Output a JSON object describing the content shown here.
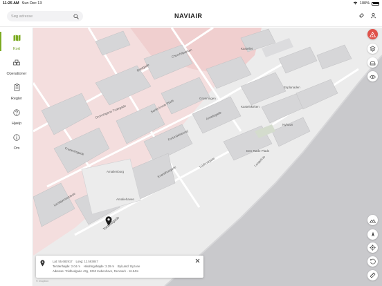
{
  "status_bar": {
    "time": "11:25 AM",
    "date": "Sun Dec 13",
    "battery": "100%"
  },
  "header": {
    "search_placeholder": "Søg adresse",
    "brand": "NAVIAIR"
  },
  "sidebar": {
    "items": [
      {
        "label": "Kort",
        "icon": "map-icon",
        "active": true
      },
      {
        "label": "Operationer",
        "icon": "drones-icon",
        "active": false
      },
      {
        "label": "Regler",
        "icon": "clipboard-icon",
        "active": false
      },
      {
        "label": "Hjælp",
        "icon": "question-icon",
        "active": false
      },
      {
        "label": "Om",
        "icon": "info-icon",
        "active": false
      }
    ]
  },
  "map": {
    "labels": {
      "amalienborg": "Amalienborg",
      "toldbodgade_1": "Toldbodgade",
      "toldbodgade_2": "Toldbodgade",
      "frederiks": "Frederiksgade",
      "amaliegade": "Amaliegade",
      "kastellet": "Kastellet",
      "esplanaden": "Esplanaden",
      "bredgade": "Bredgade",
      "larsbjorn": "Larsbjørnsstræde",
      "nyhavn": "Nyhavn",
      "opera": "Den Røde Plads",
      "langelinie": "Langelinie",
      "forbindelse": "Forbindelsesvej",
      "grønningen": "Grønningen",
      "churchill": "Churchillparken",
      "kapel": "Kastelskirken",
      "odd": "Amaliehaven",
      "sankt": "Sankt Annæ Plads",
      "dronning": "Dronningens Tværgade",
      "kvæst": "Kvæsthusgade"
    },
    "copyright": "© mapbox"
  },
  "info_panel": {
    "lat_label": "Lat:",
    "lat": "55.682917",
    "long_label": "Long:",
    "long": "12.593847",
    "terrain_label": "Terrænhøjde:",
    "terrain": "2.04 m",
    "obstacle_label": "Hindringshøjde:",
    "obstacle": "3.29 m",
    "area_label": "By/Land:",
    "area": "Byzone",
    "address_label": "Adresse:",
    "address": "Toldbodgade 43g, 1253 København, Denmark - 16.54m"
  },
  "colors": {
    "accent": "#7cab22",
    "alert": "#e0524a",
    "restricted_zone": "#f2d9d9",
    "water": "#c9c9cc"
  }
}
